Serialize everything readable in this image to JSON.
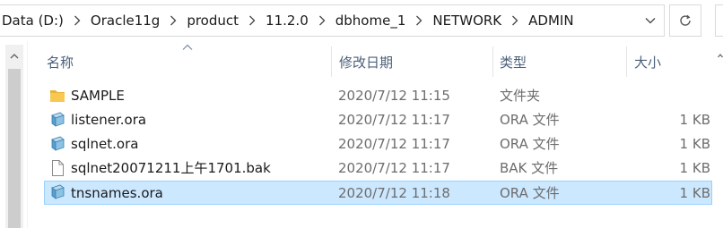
{
  "address_bar": {
    "crumbs": [
      "Data (D:)",
      "Oracle11g",
      "product",
      "11.2.0",
      "dbhome_1",
      "NETWORK",
      "ADMIN"
    ]
  },
  "columns": {
    "name": "名称",
    "date": "修改日期",
    "type": "类型",
    "size": "大小"
  },
  "files": [
    {
      "name": "SAMPLE",
      "date": "2020/7/12 11:15",
      "type": "文件夹",
      "size": "",
      "icon": "folder-icon"
    },
    {
      "name": "listener.ora",
      "date": "2020/7/12 11:17",
      "type": "ORA 文件",
      "size": "1 KB",
      "icon": "ora-file-icon"
    },
    {
      "name": "sqlnet.ora",
      "date": "2020/7/12 11:17",
      "type": "ORA 文件",
      "size": "1 KB",
      "icon": "ora-file-icon"
    },
    {
      "name": "sqlnet20071211上午1701.bak",
      "date": "2020/7/12 11:17",
      "type": "BAK 文件",
      "size": "1 KB",
      "icon": "blank-file-icon"
    },
    {
      "name": "tnsnames.ora",
      "date": "2020/7/12 11:18",
      "type": "ORA 文件",
      "size": "1 KB",
      "icon": "ora-file-icon",
      "selected": true
    }
  ],
  "colors": {
    "selection_bg": "#cce8ff",
    "selection_border": "#99d1ff",
    "header_text": "#4c607a",
    "folder": "#f8c851"
  }
}
